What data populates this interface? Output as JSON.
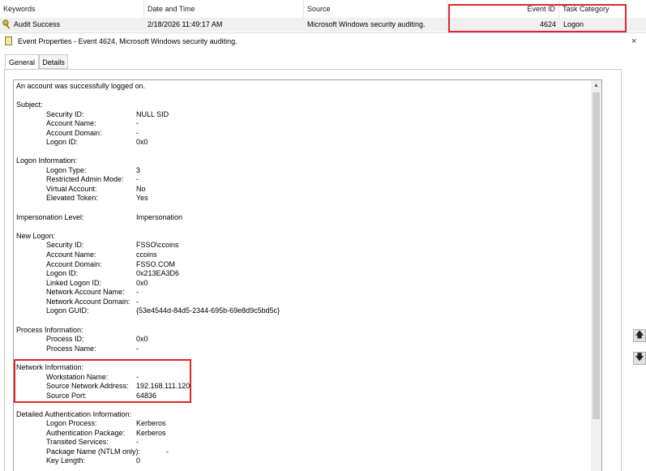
{
  "list": {
    "columns": {
      "keywords": "Keywords",
      "date_time": "Date and Time",
      "source": "Source",
      "event_id": "Event ID",
      "task_category": "Task Category"
    },
    "row": {
      "keywords": "Audit Success",
      "date_time": "2/18/2026 11:49:17 AM",
      "source": "Microsoft Windows security auditing.",
      "event_id": "4624",
      "task_category": "Logon"
    }
  },
  "properties": {
    "title": "Event Properties - Event 4624, Microsoft Windows security auditing.",
    "close": "×"
  },
  "tabs": {
    "general": "General",
    "details": "Details"
  },
  "details": {
    "intro": "An account was successfully logged on.",
    "subject": {
      "heading": "Subject:",
      "security_id_label": "Security ID:",
      "security_id": "NULL SID",
      "account_name_label": "Account Name:",
      "account_name": "-",
      "account_domain_label": "Account Domain:",
      "account_domain": "-",
      "logon_id_label": "Logon ID:",
      "logon_id": "0x0"
    },
    "logon_info": {
      "heading": "Logon Information:",
      "logon_type_label": "Logon Type:",
      "logon_type": "3",
      "restricted_admin_label": "Restricted Admin Mode:",
      "restricted_admin": "-",
      "virtual_account_label": "Virtual Account:",
      "virtual_account": "No",
      "elevated_token_label": "Elevated Token:",
      "elevated_token": "Yes"
    },
    "impersonation": {
      "label": "Impersonation Level:",
      "value": "Impersonation"
    },
    "new_logon": {
      "heading": "New Logon:",
      "security_id_label": "Security ID:",
      "security_id": "FSSO\\ccoins",
      "account_name_label": "Account Name:",
      "account_name": "ccoins",
      "account_domain_label": "Account Domain:",
      "account_domain": "FSSO.COM",
      "logon_id_label": "Logon ID:",
      "logon_id": "0x213EA3D6",
      "linked_logon_id_label": "Linked Logon ID:",
      "linked_logon_id": "0x0",
      "network_account_name_label": "Network Account Name:",
      "network_account_name": "-",
      "network_account_domain_label": "Network Account Domain:",
      "network_account_domain": "-",
      "logon_guid_label": "Logon GUID:",
      "logon_guid": "{53e4544d-84d5-2344-695b-69e8d9c5bd5c}"
    },
    "process_info": {
      "heading": "Process Information:",
      "process_id_label": "Process ID:",
      "process_id": "0x0",
      "process_name_label": "Process Name:",
      "process_name": "-"
    },
    "network_info": {
      "heading": "Network Information:",
      "workstation_name_label": "Workstation Name:",
      "workstation_name": "-",
      "source_address_label": "Source Network Address:",
      "source_address": "192.168.111.120",
      "source_port_label": "Source Port:",
      "source_port": "64836"
    },
    "auth_info": {
      "heading": "Detailed Authentication Information:",
      "logon_process_label": "Logon Process:",
      "logon_process": "Kerberos",
      "auth_package_label": "Authentication Package:",
      "auth_package": "Kerberos",
      "transited_services_label": "Transited Services:",
      "transited_services": "-",
      "package_name_label": "Package Name (NTLM only):",
      "package_name": "-",
      "key_length_label": "Key Length:",
      "key_length": "0"
    }
  },
  "side_buttons": {
    "up": "🡅",
    "down": "🡇"
  },
  "scrollbar": {
    "up_arrow": "▲"
  },
  "colors": {
    "highlight_box": "#e1262d",
    "row_bg": "#f0f0f0",
    "scrollbar": "#f0f0f0"
  },
  "icons": {
    "row": "key-icon",
    "title": "event-properties-icon"
  }
}
